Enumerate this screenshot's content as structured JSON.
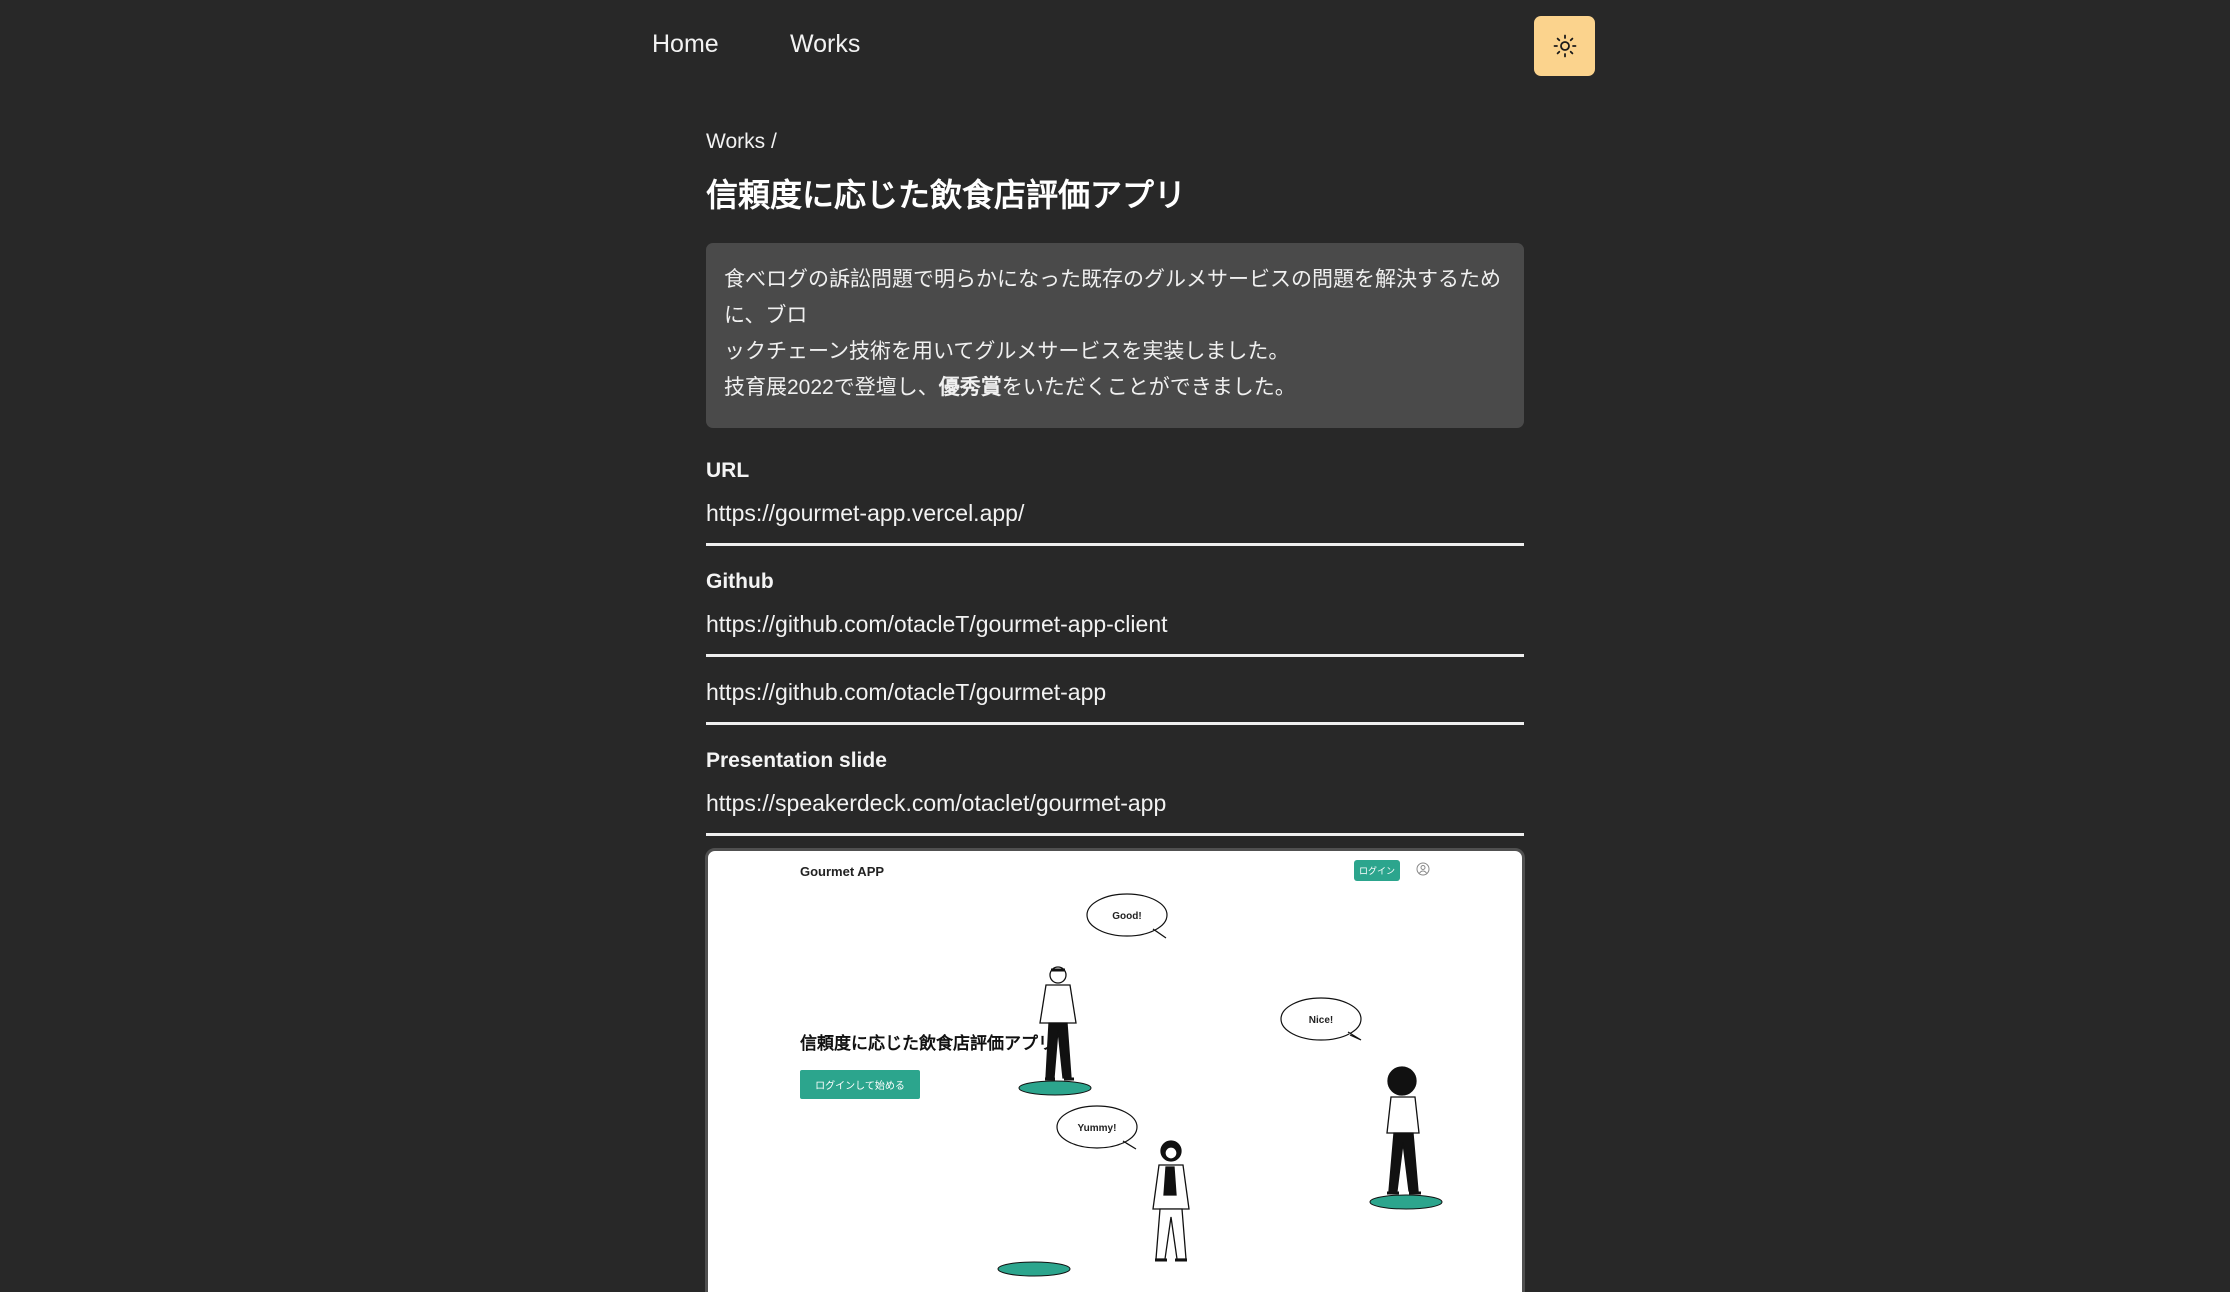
{
  "nav": {
    "home": "Home",
    "works": "Works",
    "theme_icon": "sun-icon",
    "theme_button_color": "#fbd38d"
  },
  "breadcrumb": "Works /",
  "title": "信頼度に応じた飲食店評価アプリ",
  "description": {
    "line1": "食べログの訴訟問題で明らかになった既存のグルメサービスの問題を解決するために、ブロ",
    "line2": "ックチェーン技術を用いてグルメサービスを実装しました。",
    "line3_pre": "技育展2022で登壇し、",
    "line3_bold": "優秀賞",
    "line3_post": "をいただくことができました。"
  },
  "sections": {
    "url": {
      "label": "URL",
      "link": "https://gourmet-app.vercel.app/"
    },
    "github": {
      "label": "Github",
      "links": [
        "https://github.com/otacleT/gourmet-app-client",
        "https://github.com/otacleT/gourmet-app"
      ]
    },
    "presentation": {
      "label": "Presentation slide",
      "link": "https://speakerdeck.com/otaclet/gourmet-app"
    }
  },
  "preview": {
    "brand": "Gourmet APP",
    "login": "ログイン",
    "heading": "信頼度に応じた飲食店評価アプリ",
    "start_button": "ログインして始める",
    "bubbles": [
      "Good!",
      "Nice!",
      "Yummy!"
    ],
    "accent_color": "#2ca58d"
  }
}
